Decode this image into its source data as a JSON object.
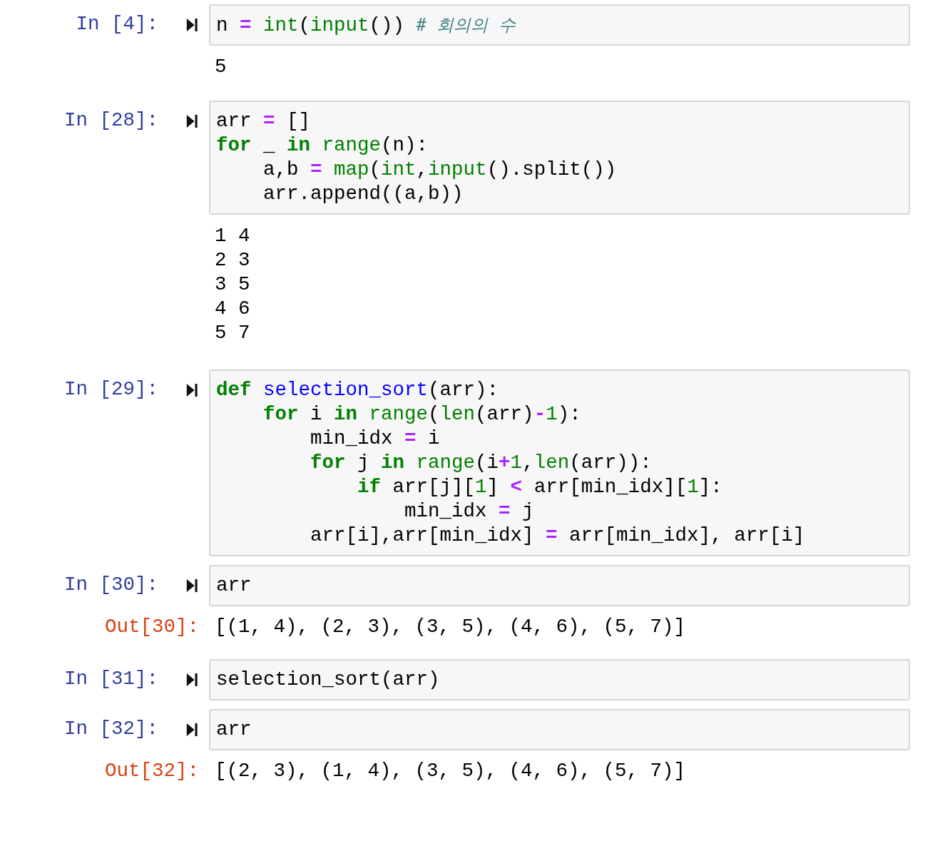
{
  "cells": [
    {
      "prompt": "In [4]:",
      "code": [
        [
          {
            "text": "n ",
            "kind": "plain"
          },
          {
            "text": "= ",
            "kind": "op"
          },
          {
            "text": "int",
            "kind": "builtin"
          },
          {
            "text": "(",
            "kind": "plain"
          },
          {
            "text": "input",
            "kind": "builtin"
          },
          {
            "text": "()) ",
            "kind": "plain"
          },
          {
            "text": "# 회의의 수",
            "kind": "comment"
          }
        ]
      ],
      "output": {
        "kind": "stream",
        "lines": [
          "5"
        ]
      }
    },
    {
      "prompt": "In [28]:",
      "code": [
        [
          {
            "text": "arr ",
            "kind": "plain"
          },
          {
            "text": "=",
            "kind": "op"
          },
          {
            "text": " []",
            "kind": "plain"
          }
        ],
        [
          {
            "text": "for",
            "kind": "kw"
          },
          {
            "text": " _ ",
            "kind": "plain"
          },
          {
            "text": "in ",
            "kind": "kw"
          },
          {
            "text": "range",
            "kind": "builtin"
          },
          {
            "text": "(n):",
            "kind": "plain"
          }
        ],
        [
          {
            "text": "    a,b ",
            "kind": "plain"
          },
          {
            "text": "= ",
            "kind": "op"
          },
          {
            "text": "map",
            "kind": "builtin"
          },
          {
            "text": "(",
            "kind": "plain"
          },
          {
            "text": "int",
            "kind": "builtin"
          },
          {
            "text": ",",
            "kind": "plain"
          },
          {
            "text": "input",
            "kind": "builtin"
          },
          {
            "text": "().split())",
            "kind": "plain"
          }
        ],
        [
          {
            "text": "    arr.append((a,b))",
            "kind": "plain"
          }
        ]
      ],
      "output": {
        "kind": "stream",
        "lines": [
          "1 4",
          "2 3",
          "3 5",
          "4 6",
          "5 7"
        ]
      }
    },
    {
      "prompt": "In [29]:",
      "code": [
        [
          {
            "text": "def ",
            "kind": "kw"
          },
          {
            "text": "selection_sort",
            "kind": "defname"
          },
          {
            "text": "(arr):",
            "kind": "plain"
          }
        ],
        [
          {
            "text": "    for",
            "kind": "kw"
          },
          {
            "text": " i ",
            "kind": "plain"
          },
          {
            "text": "in ",
            "kind": "kw"
          },
          {
            "text": "range",
            "kind": "builtin"
          },
          {
            "text": "(",
            "kind": "plain"
          },
          {
            "text": "len",
            "kind": "builtin"
          },
          {
            "text": "(arr)",
            "kind": "plain"
          },
          {
            "text": "-",
            "kind": "op"
          },
          {
            "text": "1",
            "kind": "num"
          },
          {
            "text": "):",
            "kind": "plain"
          }
        ],
        [
          {
            "text": "        min_idx ",
            "kind": "plain"
          },
          {
            "text": "=",
            "kind": "op"
          },
          {
            "text": " i",
            "kind": "plain"
          }
        ],
        [
          {
            "text": "        for",
            "kind": "kw"
          },
          {
            "text": " j ",
            "kind": "plain"
          },
          {
            "text": "in ",
            "kind": "kw"
          },
          {
            "text": "range",
            "kind": "builtin"
          },
          {
            "text": "(i",
            "kind": "plain"
          },
          {
            "text": "+",
            "kind": "op"
          },
          {
            "text": "1",
            "kind": "num"
          },
          {
            "text": ",",
            "kind": "plain"
          },
          {
            "text": "len",
            "kind": "builtin"
          },
          {
            "text": "(arr)):",
            "kind": "plain"
          }
        ],
        [
          {
            "text": "            if",
            "kind": "kw"
          },
          {
            "text": " arr[j][",
            "kind": "plain"
          },
          {
            "text": "1",
            "kind": "num"
          },
          {
            "text": "] ",
            "kind": "plain"
          },
          {
            "text": "<",
            "kind": "op"
          },
          {
            "text": " arr[min_idx][",
            "kind": "plain"
          },
          {
            "text": "1",
            "kind": "num"
          },
          {
            "text": "]:",
            "kind": "plain"
          }
        ],
        [
          {
            "text": "                min_idx ",
            "kind": "plain"
          },
          {
            "text": "=",
            "kind": "op"
          },
          {
            "text": " j",
            "kind": "plain"
          }
        ],
        [
          {
            "text": "        arr[i],arr[min_idx] ",
            "kind": "plain"
          },
          {
            "text": "=",
            "kind": "op"
          },
          {
            "text": " arr[min_idx], arr[i]",
            "kind": "plain"
          }
        ]
      ]
    },
    {
      "prompt": "In [30]:",
      "code": [
        [
          {
            "text": "arr",
            "kind": "plain"
          }
        ]
      ],
      "output": {
        "kind": "result",
        "prompt": "Out[30]:",
        "lines": [
          "[(1, 4), (2, 3), (3, 5), (4, 6), (5, 7)]"
        ]
      }
    },
    {
      "prompt": "In [31]:",
      "code": [
        [
          {
            "text": "selection_sort(arr)",
            "kind": "plain"
          }
        ]
      ]
    },
    {
      "prompt": "In [32]:",
      "code": [
        [
          {
            "text": "arr",
            "kind": "plain"
          }
        ]
      ],
      "output": {
        "kind": "result",
        "prompt": "Out[32]:",
        "lines": [
          "[(2, 3), (1, 4), (3, 5), (4, 6), (5, 7)]"
        ]
      }
    }
  ]
}
